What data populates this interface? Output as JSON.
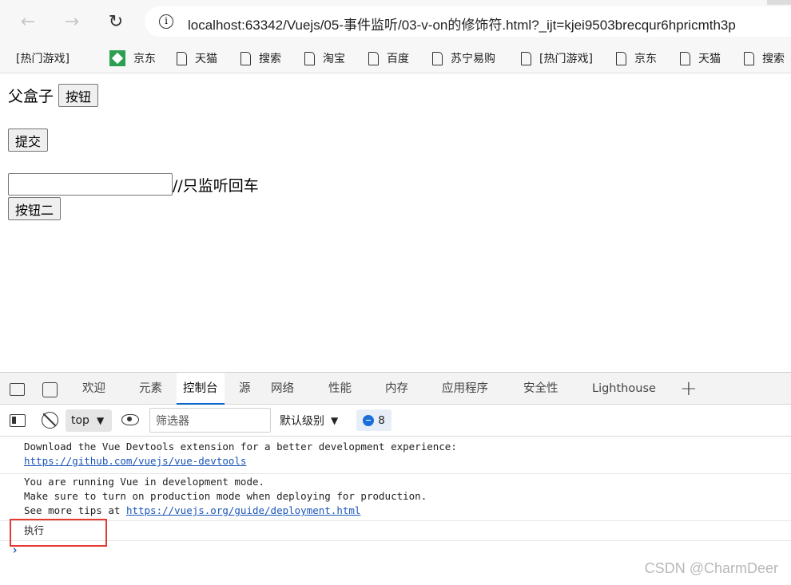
{
  "browser": {
    "url": "localhost:63342/Vuejs/05-事件监听/03-v-on的修饰符.html?_ijt=kjei9503brecqur6hpricmth3p"
  },
  "bookmarks": [
    {
      "label": "[热门游戏]",
      "icon": "none-icon"
    },
    {
      "label": "京东",
      "icon": "jd-icon"
    },
    {
      "label": "天猫",
      "icon": "document-icon"
    },
    {
      "label": "搜索",
      "icon": "document-icon"
    },
    {
      "label": "淘宝",
      "icon": "document-icon"
    },
    {
      "label": "百度",
      "icon": "document-icon"
    },
    {
      "label": "苏宁易购",
      "icon": "document-icon"
    },
    {
      "label": "[热门游戏]",
      "icon": "document-icon"
    },
    {
      "label": "京东",
      "icon": "document-icon"
    },
    {
      "label": "天猫",
      "icon": "document-icon"
    },
    {
      "label": "搜索",
      "icon": "document-icon"
    }
  ],
  "page": {
    "parent_label": "父盒子",
    "parent_button": "按钮",
    "submit_button": "提交",
    "input_value": "",
    "input_hint": "//只监听回车",
    "button_two": "按钮二"
  },
  "devtools": {
    "tabs": [
      "欢迎",
      "元素",
      "控制台",
      "源",
      "网络",
      "性能",
      "内存",
      "应用程序",
      "安全性",
      "Lighthouse"
    ],
    "active_tab": "控制台",
    "context": "top",
    "filter_placeholder": "筛选器",
    "level": "默认级别",
    "issues_count": "8"
  },
  "console": {
    "msg1_line1": "Download the Vue Devtools extension for a better development experience:",
    "msg1_link": "https://github.com/vuejs/vue-devtools",
    "msg2_line1": "You are running Vue in development mode.",
    "msg2_line2": "Make sure to turn on production mode when deploying for production.",
    "msg2_line3_prefix": "See more tips at ",
    "msg2_link": "https://vuejs.org/guide/deployment.html",
    "log_output": "执行"
  },
  "watermark": "CSDN @CharmDeer",
  "colors": {
    "highlight_border": "#e53935",
    "link": "#1a55b8",
    "active_tab_underline": "#0a64c8"
  }
}
